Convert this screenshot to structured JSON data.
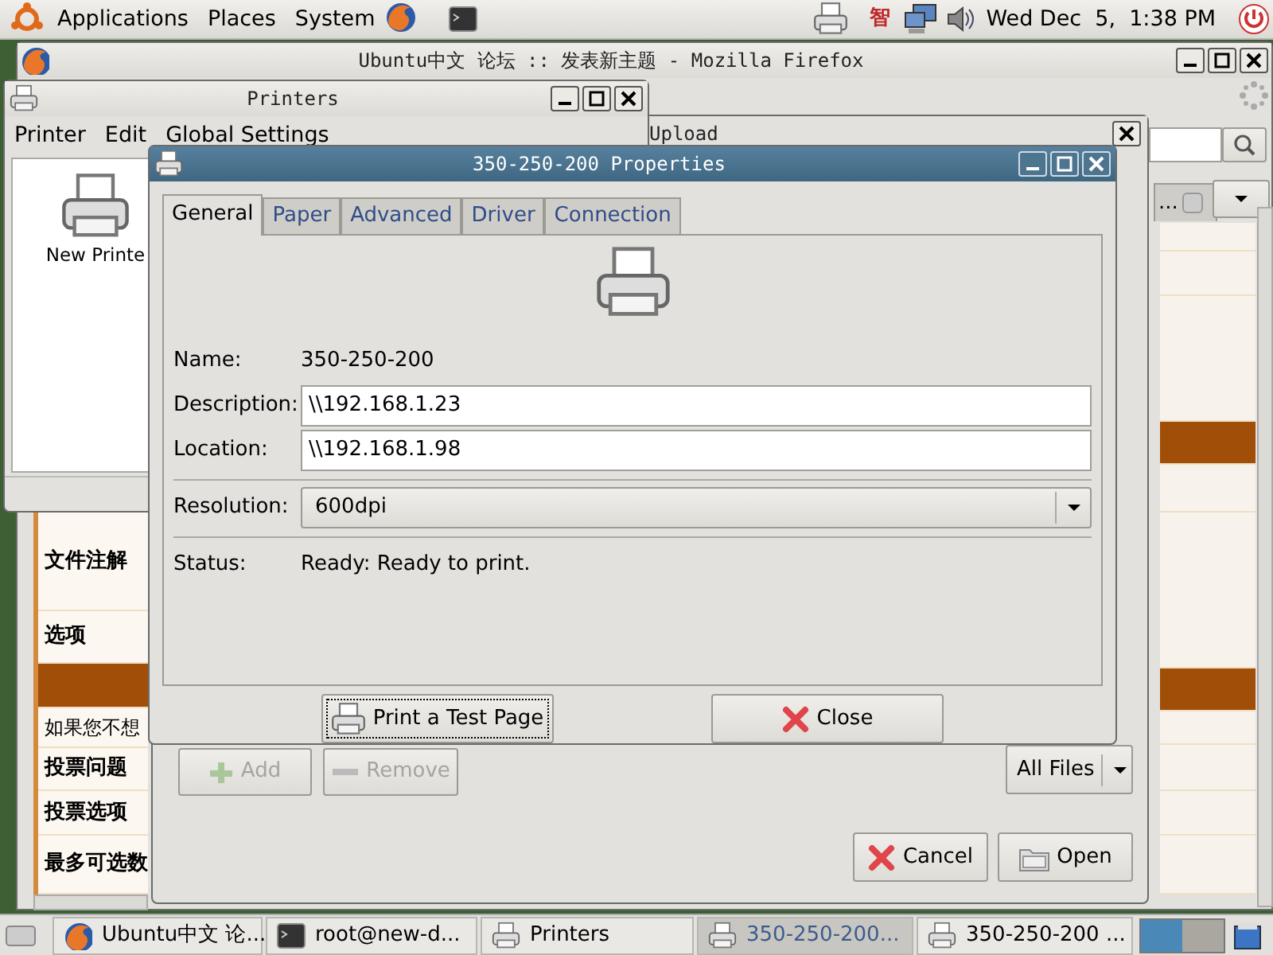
{
  "top_panel": {
    "menus": [
      "Applications",
      "Places",
      "System"
    ],
    "input_method": "智",
    "clock": "Wed Dec  5,  1:38 PM"
  },
  "browser_window": {
    "title": "Ubuntu中文 论坛 :: 发表新主题 - Mozilla Firefox",
    "tabs": [
      {
        "label": "..."
      }
    ]
  },
  "forum_rows": [
    {
      "kind": "label",
      "text": "文件注解"
    },
    {
      "kind": "label",
      "text": "选项"
    },
    {
      "kind": "band"
    },
    {
      "kind": "note",
      "text": "如果您不想"
    },
    {
      "kind": "label",
      "text": "投票问题"
    },
    {
      "kind": "label",
      "text": "投票选项"
    },
    {
      "kind": "label",
      "text": "最多可选数"
    }
  ],
  "upload_dialog": {
    "title": "Upload",
    "buttons": [
      {
        "label": "Add",
        "disabled": true
      },
      {
        "label": "Remove",
        "disabled": true
      }
    ],
    "filter": "All Files",
    "actions": [
      {
        "label": "Cancel",
        "kind": "cancel"
      },
      {
        "label": "Open",
        "kind": "open"
      }
    ]
  },
  "printers_window": {
    "title": "Printers",
    "menu": [
      "Printer",
      "Edit",
      "Global Settings"
    ],
    "items": [
      {
        "label": "New Printe"
      }
    ]
  },
  "properties_dialog": {
    "title": "350-250-200 Properties",
    "tabs": [
      {
        "label": "General",
        "selected": true
      },
      {
        "label": "Paper",
        "selected": false
      },
      {
        "label": "Advanced",
        "selected": false
      },
      {
        "label": "Driver",
        "selected": false
      },
      {
        "label": "Connection",
        "selected": false
      }
    ],
    "fields": [
      {
        "kind": "text",
        "label": "Name:",
        "value": "350-250-200"
      },
      {
        "kind": "input",
        "label": "Description:",
        "value": "\\\\192.168.1.23"
      },
      {
        "kind": "input",
        "label": "Location:",
        "value": "\\\\192.168.1.98"
      },
      {
        "kind": "combo",
        "label": "Resolution:",
        "value": "600dpi"
      },
      {
        "kind": "text",
        "label": "Status:",
        "value": "Ready: Ready to print."
      }
    ],
    "buttons": [
      {
        "label": "Print a Test Page",
        "kind": "print"
      },
      {
        "label": "Close",
        "kind": "close"
      }
    ]
  },
  "taskbar": [
    {
      "label": "Ubuntu中文 论...",
      "kind": "browser",
      "selected": false
    },
    {
      "label": "root@new-d...",
      "kind": "terminal",
      "selected": false
    },
    {
      "label": "Printers",
      "kind": "printer",
      "selected": false
    },
    {
      "label": "350-250-200...",
      "kind": "printer",
      "selected": true
    },
    {
      "label": "350-250-200 ...",
      "kind": "printer",
      "selected": false
    }
  ]
}
